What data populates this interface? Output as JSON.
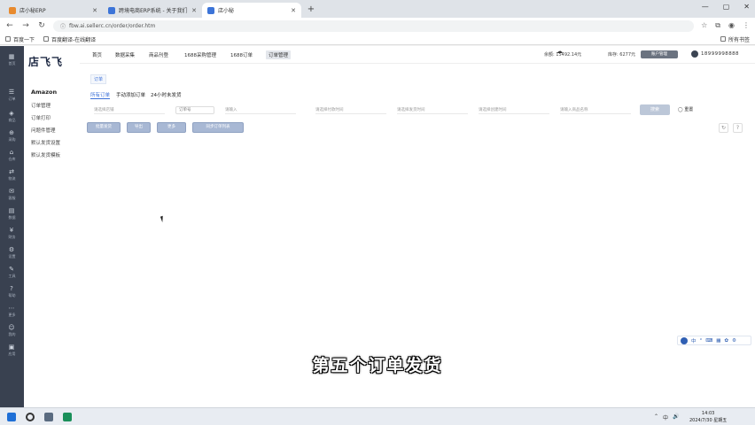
{
  "browser": {
    "tabs": [
      {
        "label": "店小秘ERP",
        "active": false
      },
      {
        "label": "跨境电商ERP系统 - 关于我们",
        "active": false
      },
      {
        "label": "店小秘",
        "active": true
      }
    ],
    "new_tab": "+",
    "window_controls": [
      "—",
      "▢",
      "✕"
    ],
    "url": "fbw.ai.sellerc.cn/order/order.htm",
    "bookmarks": [
      {
        "label": "百度一下"
      },
      {
        "label": "百度翻译-在线翻译"
      }
    ],
    "bookmarks_right": "所有书签"
  },
  "app": {
    "logo": "店飞飞",
    "platform": "Amazon",
    "side_menu": [
      "订单管理",
      "订单打印",
      "问题件管理",
      "默认发货设置",
      "默认发货模板"
    ],
    "rail_items": [
      "首页",
      "订单",
      "商品",
      "采购",
      "仓库",
      "物流",
      "客服",
      "数据",
      "财务",
      "设置",
      "工具",
      "帮助",
      "更多",
      "我的",
      "应用"
    ],
    "top_nav": [
      {
        "label": "首页",
        "selected": false
      },
      {
        "label": "数据采集",
        "selected": false
      },
      {
        "label": "商品刊登",
        "selected": false
      },
      {
        "label": "1688采购管理",
        "selected": false
      },
      {
        "label": "1688订单",
        "selected": false
      },
      {
        "label": "订单管理",
        "selected": true
      }
    ],
    "balance_text": "余额: 15492.14元",
    "stock_text": "库存: 6277元",
    "account_pill": "账户管理",
    "account": "18999998888",
    "page_tab": "订单",
    "sub_tabs": [
      {
        "label": "所有订单",
        "selected": true
      },
      {
        "label": "手动添加订单",
        "selected": false
      },
      {
        "label": "24小时未发货",
        "selected": false
      }
    ],
    "filters": [
      {
        "placeholder": "请选择店铺"
      },
      {
        "placeholder": "订单号"
      },
      {
        "placeholder": "请输入"
      },
      {
        "placeholder": "请选择付款时间"
      },
      {
        "placeholder": "请选择发货时间"
      },
      {
        "placeholder": "请选择创建时间"
      },
      {
        "placeholder": "请输入商品名称"
      }
    ],
    "search_btn": "搜索",
    "reset_btn": "重置",
    "action_buttons": [
      "批量发货",
      "导出",
      "更多",
      "同步订单列表"
    ],
    "float_toolbar": [
      "中",
      "°",
      "⌨",
      "▦",
      "✿",
      "⚙"
    ],
    "subtitle": "第五个订单发货"
  },
  "taskbar": {
    "time": "14:03",
    "date": "2024/7/30 星期五",
    "tray": [
      "⌃",
      "中",
      "🔊"
    ]
  },
  "colors": {
    "accent": "#3a6fd8",
    "rail": "#394150",
    "button": "#a8b8d4"
  }
}
